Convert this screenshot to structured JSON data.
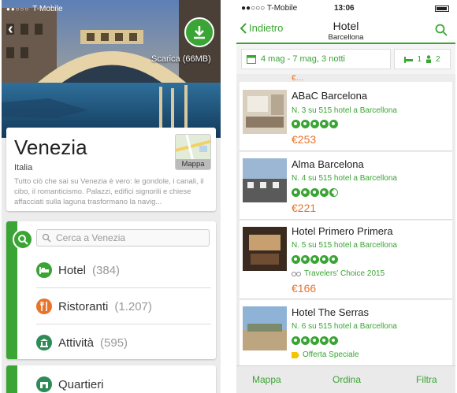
{
  "left": {
    "status": {
      "carrier": "T-Mobile"
    },
    "hero": {
      "download_label": "Scarica (66MB)"
    },
    "city": {
      "name": "Venezia",
      "country": "Italia",
      "description": "Tutto ciò che sai su Venezia è vero: le gondole, i canali, il cibo, il romanticismo. Palazzi, edifici signorili e chiese affacciati sulla laguna trasformano la navig...",
      "map_label": "Mappa"
    },
    "search": {
      "placeholder": "Cerca a Venezia"
    },
    "menu": [
      {
        "label": "Hotel",
        "count": "(384)",
        "icon": "bed-icon",
        "color": "#3aa534"
      },
      {
        "label": "Ristoranti",
        "count": "(1.207)",
        "icon": "restaurant-icon",
        "color": "#e8742a"
      },
      {
        "label": "Attività",
        "count": "(595)",
        "icon": "attractions-icon",
        "color": "#2e8b57"
      }
    ],
    "more": {
      "label": "Quartieri",
      "icon": "neighborhood-icon"
    }
  },
  "right": {
    "status": {
      "carrier": "T-Mobile",
      "time": "13:06"
    },
    "nav": {
      "back": "Indietro",
      "title": "Hotel",
      "subtitle": "Barcellona"
    },
    "filters": {
      "dates": "4 mag - 7 mag, 3 notti",
      "rooms": "1",
      "guests": "2"
    },
    "hotels": [
      {
        "name": "ABaC Barcelona",
        "rank": "N. 3 su 515 hotel a Barcellona",
        "bubbles": 5,
        "price": "€253"
      },
      {
        "name": "Alma Barcelona",
        "rank": "N. 4 su 515 hotel a Barcellona",
        "bubbles": 4.5,
        "price": "€221"
      },
      {
        "name": "Hotel Primero Primera",
        "rank": "N. 5 su 515 hotel a Barcellona",
        "bubbles": 5,
        "badge": "Travelers' Choice 2015",
        "price": "€166"
      },
      {
        "name": "Hotel The Serras",
        "rank": "N. 6 su 515 hotel a Barcellona",
        "bubbles": 5,
        "badge": "Offerta Speciale"
      }
    ],
    "tabs": {
      "map": "Mappa",
      "sort": "Ordina",
      "filter": "Filtra"
    }
  },
  "colors": {
    "accent": "#3aa534",
    "price": "#e8742a"
  }
}
